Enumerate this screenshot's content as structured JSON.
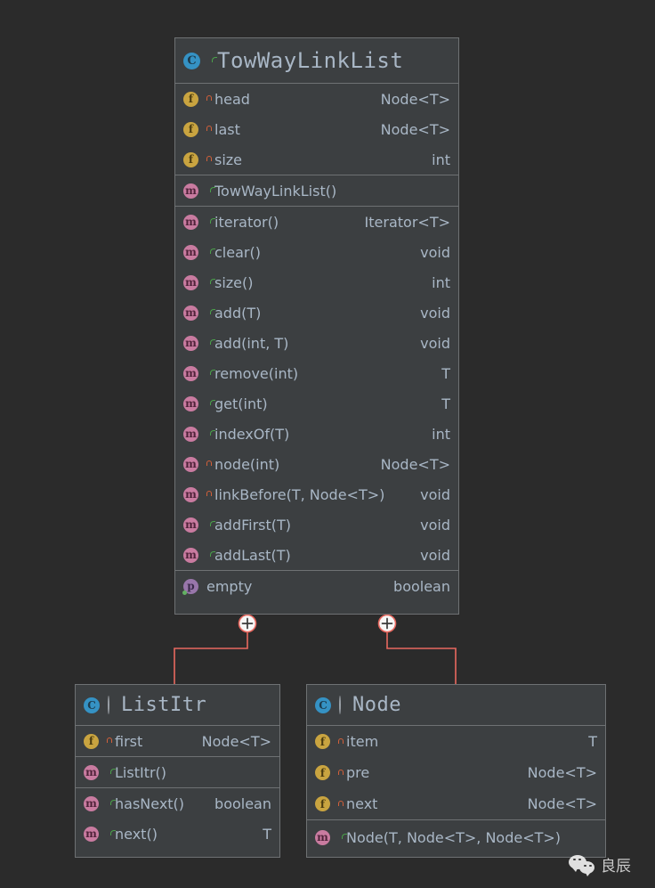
{
  "canvas": {
    "background": "#2b2b2b",
    "box_fill": "#3c3f41",
    "box_border": "#6e7173",
    "text_color": "#a9b7c6",
    "connector_color": "#e8685f"
  },
  "icon_colors": {
    "class": "#3592c4",
    "field": "#c9a440",
    "method": "#c97ba0",
    "property": "#9876aa",
    "lock_private": "#d2603a",
    "lock_public": "#4aa04a"
  },
  "classes": [
    {
      "id": "towwaylinklist",
      "title": "TowWayLinkList",
      "icon": "class-icon",
      "icon_letter": "C",
      "visibility": "public-unlocked-icon",
      "sections": [
        {
          "name": "fields",
          "rows": [
            {
              "kind": "field",
              "icon_letter": "f",
              "visibility": "private-locked-icon",
              "name": "head",
              "type": "Node<T>"
            },
            {
              "kind": "field",
              "icon_letter": "f",
              "visibility": "private-locked-icon",
              "name": "last",
              "type": "Node<T>"
            },
            {
              "kind": "field",
              "icon_letter": "f",
              "visibility": "private-locked-icon",
              "name": "size",
              "type": "int"
            }
          ]
        },
        {
          "name": "constructors",
          "rows": [
            {
              "kind": "method",
              "icon_letter": "m",
              "visibility": "public-unlocked-icon",
              "name": "TowWayLinkList()",
              "type": ""
            }
          ]
        },
        {
          "name": "methods",
          "rows": [
            {
              "kind": "method",
              "icon_letter": "m",
              "visibility": "public-unlocked-icon",
              "name": "iterator()",
              "type": "Iterator<T>"
            },
            {
              "kind": "method",
              "icon_letter": "m",
              "visibility": "public-unlocked-icon",
              "name": "clear()",
              "type": "void"
            },
            {
              "kind": "method",
              "icon_letter": "m",
              "visibility": "public-unlocked-icon",
              "name": "size()",
              "type": "int"
            },
            {
              "kind": "method",
              "icon_letter": "m",
              "visibility": "public-unlocked-icon",
              "name": "add(T)",
              "type": "void"
            },
            {
              "kind": "method",
              "icon_letter": "m",
              "visibility": "public-unlocked-icon",
              "name": "add(int, T)",
              "type": "void"
            },
            {
              "kind": "method",
              "icon_letter": "m",
              "visibility": "public-unlocked-icon",
              "name": "remove(int)",
              "type": "T"
            },
            {
              "kind": "method",
              "icon_letter": "m",
              "visibility": "public-unlocked-icon",
              "name": "get(int)",
              "type": "T"
            },
            {
              "kind": "method",
              "icon_letter": "m",
              "visibility": "public-unlocked-icon",
              "name": "indexOf(T)",
              "type": "int"
            },
            {
              "kind": "method",
              "icon_letter": "m",
              "visibility": "private-locked-icon",
              "name": "node(int)",
              "type": "Node<T>"
            },
            {
              "kind": "method",
              "icon_letter": "m",
              "visibility": "private-locked-icon",
              "name": "linkBefore(T, Node<T>)",
              "type": "void"
            },
            {
              "kind": "method",
              "icon_letter": "m",
              "visibility": "public-unlocked-icon",
              "name": "addFirst(T)",
              "type": "void"
            },
            {
              "kind": "method",
              "icon_letter": "m",
              "visibility": "public-unlocked-icon",
              "name": "addLast(T)",
              "type": "void"
            }
          ]
        },
        {
          "name": "properties",
          "rows": [
            {
              "kind": "property",
              "icon_letter": "p",
              "visibility": "none",
              "name": "empty",
              "type": "boolean"
            }
          ]
        }
      ]
    },
    {
      "id": "listitr",
      "title": "ListItr",
      "icon": "class-icon",
      "icon_letter": "C",
      "visibility": "package-private-icon",
      "sections": [
        {
          "name": "fields",
          "rows": [
            {
              "kind": "field",
              "icon_letter": "f",
              "visibility": "private-locked-icon",
              "name": "first",
              "type": "Node<T>"
            }
          ]
        },
        {
          "name": "constructors",
          "rows": [
            {
              "kind": "method",
              "icon_letter": "m",
              "visibility": "public-unlocked-icon",
              "name": "ListItr()",
              "type": ""
            }
          ]
        },
        {
          "name": "methods",
          "rows": [
            {
              "kind": "method",
              "icon_letter": "m",
              "visibility": "public-unlocked-icon",
              "name": "hasNext()",
              "type": "boolean"
            },
            {
              "kind": "method",
              "icon_letter": "m",
              "visibility": "public-unlocked-icon",
              "name": "next()",
              "type": "T"
            }
          ]
        }
      ]
    },
    {
      "id": "node",
      "title": "Node",
      "icon": "class-icon",
      "icon_letter": "C",
      "visibility": "package-private-icon",
      "sections": [
        {
          "name": "fields",
          "rows": [
            {
              "kind": "field",
              "icon_letter": "f",
              "visibility": "private-locked-icon",
              "name": "item",
              "type": "T"
            },
            {
              "kind": "field",
              "icon_letter": "f",
              "visibility": "private-locked-icon",
              "name": "pre",
              "type": "Node<T>"
            },
            {
              "kind": "field",
              "icon_letter": "f",
              "visibility": "private-locked-icon",
              "name": "next",
              "type": "Node<T>"
            }
          ]
        },
        {
          "name": "constructors",
          "rows": [
            {
              "kind": "method",
              "icon_letter": "m",
              "visibility": "public-unlocked-icon",
              "name": "Node(T, Node<T>, Node<T>)",
              "type": ""
            }
          ]
        }
      ]
    }
  ],
  "connectors": [
    {
      "id": "towwaylinklist-to-listitr",
      "marker": "plus-circle",
      "from": "TowWayLinkList",
      "to": "ListItr"
    },
    {
      "id": "towwaylinklist-to-node",
      "marker": "plus-circle",
      "from": "TowWayLinkList",
      "to": "Node"
    }
  ],
  "watermark": {
    "icon": "wechat-icon",
    "label": "良辰"
  }
}
